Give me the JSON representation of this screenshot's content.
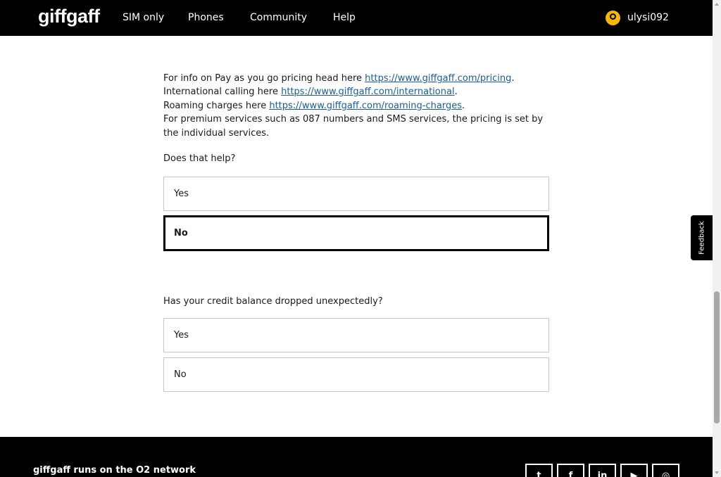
{
  "header": {
    "logo": "giffgaff",
    "nav": [
      "SIM only",
      "Phones",
      "Community",
      "Help"
    ],
    "username": "ulysi092"
  },
  "info": {
    "line1_text": "For info on Pay as you go pricing head here ",
    "line1_link": "https://www.giffgaff.com/pricing",
    "line1_end": ".",
    "line2_text": "International calling here ",
    "line2_link": "https://www.giffgaff.com/international",
    "line2_end": ".",
    "line3_text": "Roaming charges here ",
    "line3_link": "https://www.giffgaff.com/roaming-charges",
    "line3_end": ".",
    "line4_text": "For premium services such as 087 numbers and SMS services, the pricing is set by the individual services."
  },
  "help_question": {
    "text": "Does that help?",
    "options": [
      "Yes",
      "No"
    ],
    "selected": "No"
  },
  "credit_question": {
    "text": "Has your credit balance dropped unexpectedly?",
    "options": [
      "Yes",
      "No"
    ]
  },
  "feedback_label": "Feedback",
  "footer": {
    "network_text": "giffgaff runs on the O2 network",
    "social_icons": [
      "twitter-icon",
      "facebook-icon",
      "linkedin-icon",
      "youtube-icon",
      "instagram-icon"
    ]
  },
  "colors": {
    "header_bg": "#000000",
    "link": "#1a5c9e",
    "accent_avatar": "#f5b800"
  }
}
